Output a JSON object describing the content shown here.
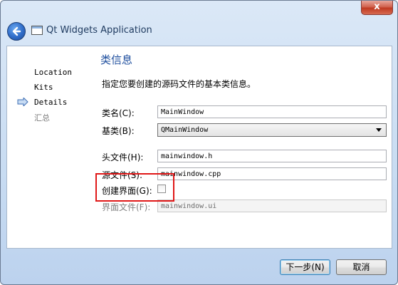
{
  "window": {
    "close_symbol": "x"
  },
  "app": {
    "title": "Qt Widgets Application"
  },
  "nav": {
    "items": [
      {
        "label": "Location",
        "state": "done"
      },
      {
        "label": "Kits",
        "state": "done"
      },
      {
        "label": "Details",
        "state": "current"
      },
      {
        "label": "汇总",
        "state": "pending"
      }
    ]
  },
  "page": {
    "title": "类信息",
    "subtitle": "指定您要创建的源码文件的基本类信息。"
  },
  "form": {
    "class_name": {
      "label": "类名(C):",
      "value": "MainWindow"
    },
    "base_class": {
      "label": "基类(B):",
      "value": "QMainWindow"
    },
    "header_file": {
      "label": "头文件(H):",
      "value": "mainwindow.h"
    },
    "source_file": {
      "label": "源文件(S):",
      "value": "mainwindow.cpp"
    },
    "generate_form": {
      "label": "创建界面(G):",
      "checked": false
    },
    "form_file": {
      "label": "界面文件(F):",
      "value": "mainwindow.ui"
    }
  },
  "buttons": {
    "next": "下一步(N)",
    "cancel": "取消"
  },
  "colors": {
    "accent_title": "#1f4f9e",
    "highlight_box": "#e01818"
  }
}
